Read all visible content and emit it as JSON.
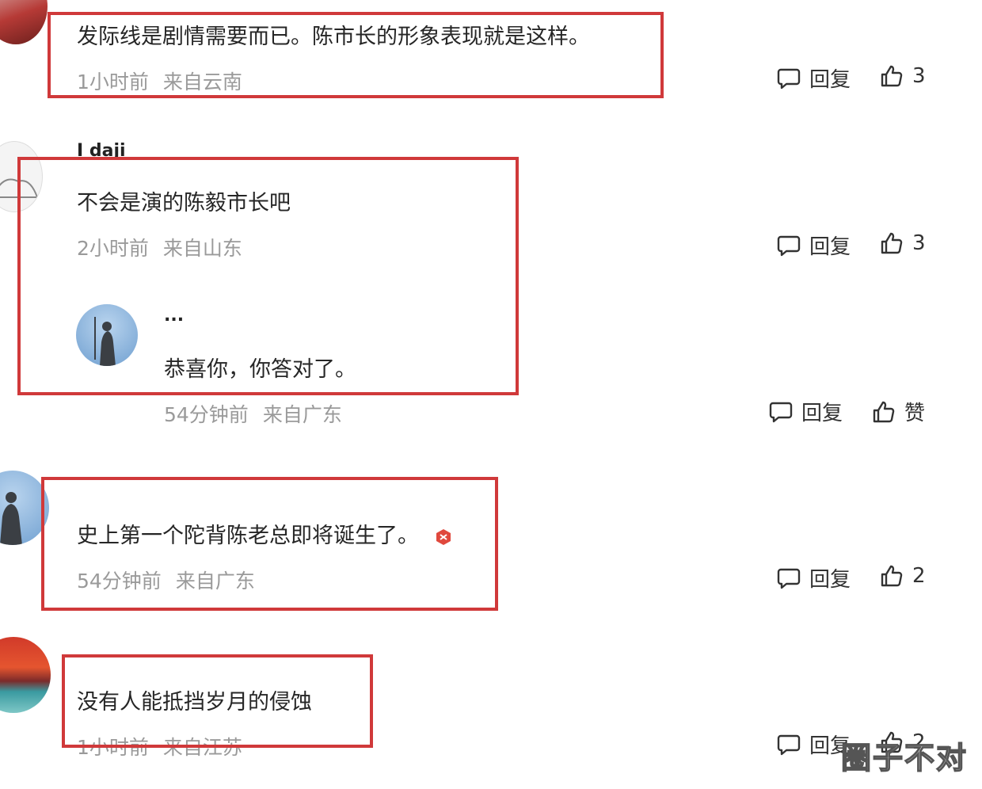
{
  "comments": [
    {
      "text": "发际线是剧情需要而已。陈市长的形象表现就是这样。",
      "time": "1小时前",
      "location": "来自云南",
      "reply_label": "回复",
      "like_count": "3"
    },
    {
      "username": "I daji",
      "text": "不会是演的陈毅市长吧",
      "time": "2小时前",
      "location": "来自山东",
      "reply_label": "回复",
      "like_count": "3",
      "sub_reply": {
        "username": "...",
        "text": "恭喜你，你答对了。",
        "time": "54分钟前",
        "location": "来自广东",
        "reply_label": "回复",
        "like_label": "赞"
      }
    },
    {
      "text": "史上第一个陀背陈老总即将诞生了。",
      "time": "54分钟前",
      "location": "来自广东",
      "reply_label": "回复",
      "like_count": "2"
    },
    {
      "text": "没有人能抵挡岁月的侵蚀",
      "time": "1小时前",
      "location": "来自江苏",
      "reply_label": "回复",
      "like_count": "2"
    }
  ],
  "watermark": "圈子不对",
  "colors": {
    "highlight_box": "#d0393a",
    "meta_text": "#9a9a9a"
  },
  "icons": [
    "comment-bubble-icon",
    "thumbs-up-icon"
  ]
}
